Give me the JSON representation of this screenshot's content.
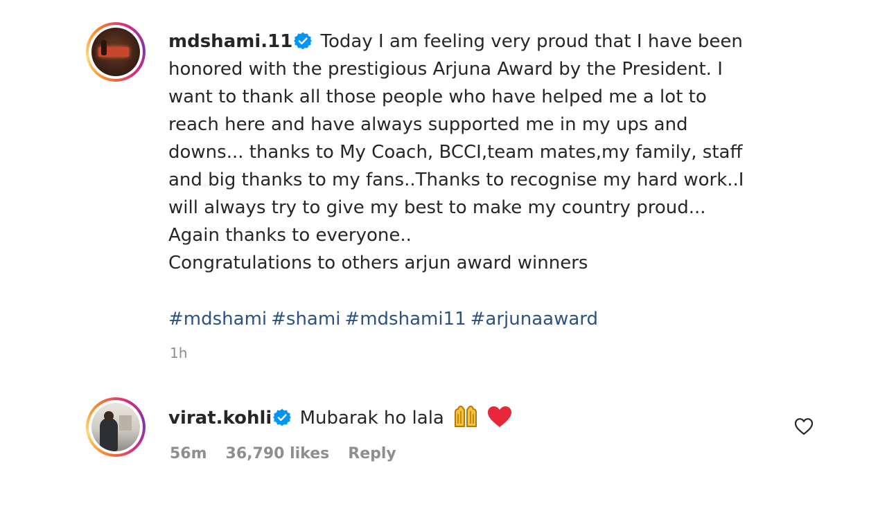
{
  "post": {
    "username": "mdshami.11",
    "verified_icon": "verified-badge-icon",
    "caption": " Today I am feeling very proud that I have been\nhonored with the prestigious Arjuna Award by the President. I\nwant to thank all those people who have helped me a lot to\nreach here and have always supported me in my ups and\ndowns... thanks to My Coach, BCCI,team mates,my family, staff\nand big thanks to my fans..Thanks to recognise my hard work..I\nwill always try to give my best to make my country proud...\nAgain thanks to everyone..\nCongratulations to others arjun award winners",
    "hashtags": [
      "#mdshami",
      "#shami",
      "#mdshami11",
      "#arjunaaward"
    ],
    "time": "1h"
  },
  "comment": {
    "username": "virat.kohli",
    "verified_icon": "verified-badge-icon",
    "text": "Mubarak ho lala",
    "emojis": [
      "raised-hands-emoji",
      "red-heart-emoji"
    ],
    "time": "56m",
    "likes": "36,790 likes",
    "reply_label": "Reply",
    "like_icon": "heart-outline-icon"
  },
  "colors": {
    "text": "#262626",
    "secondary": "#8e8e8e",
    "hashtag": "#2b5184",
    "verified": "#0095f6"
  }
}
